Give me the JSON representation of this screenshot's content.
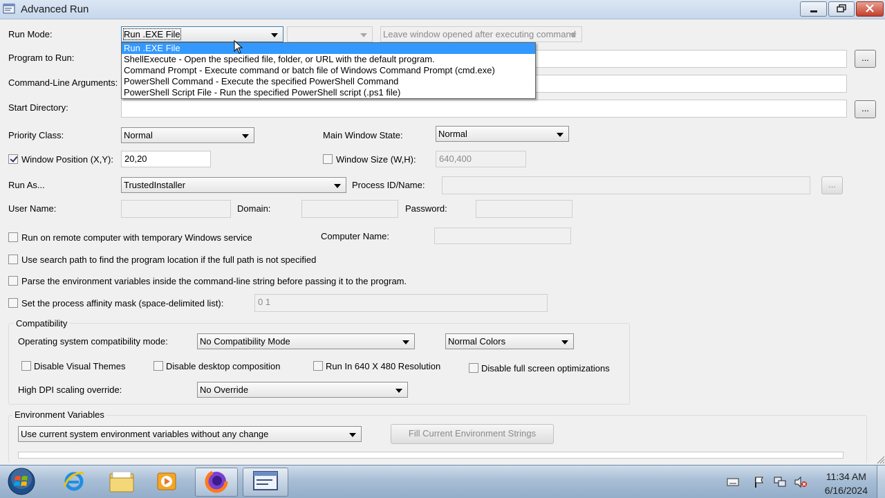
{
  "window": {
    "title": "Advanced Run"
  },
  "run_mode": {
    "label": "Run Mode:",
    "selected": "Run .EXE File",
    "secondary_combo": "",
    "leave_window": "Leave window opened after executing command"
  },
  "run_mode_options": [
    "Run .EXE File",
    "ShellExecute - Open the specified file, folder, or URL with the default program.",
    "Command Prompt - Execute command or batch file of Windows Command Prompt (cmd.exe)",
    "PowerShell Command - Execute the specified PowerShell Command",
    "PowerShell Script File - Run the specified PowerShell script (.ps1 file)"
  ],
  "program": {
    "label": "Program to Run:",
    "value": "",
    "browse": "..."
  },
  "args": {
    "label": "Command-Line Arguments:",
    "value": ""
  },
  "start_dir": {
    "label": "Start Directory:",
    "value": "",
    "browse": "..."
  },
  "priority": {
    "label": "Priority Class:",
    "value": "Normal"
  },
  "main_window_state": {
    "label": "Main Window State:",
    "value": "Normal"
  },
  "window_position": {
    "label": "Window Position (X,Y):",
    "checked": true,
    "value": "20,20"
  },
  "window_size": {
    "label": "Window Size (W,H):",
    "checked": false,
    "value": "640,400"
  },
  "run_as": {
    "label": "Run As...",
    "value": "TrustedInstaller"
  },
  "process_id": {
    "label": "Process ID/Name:",
    "value": "",
    "browse": "..."
  },
  "credentials": {
    "user_label": "User Name:",
    "user_value": "",
    "domain_label": "Domain:",
    "domain_value": "",
    "password_label": "Password:",
    "password_value": ""
  },
  "options": {
    "remote": "Run on remote computer with temporary Windows service",
    "computer_name_label": "Computer Name:",
    "computer_name_value": "",
    "search_path": "Use search path to find the program location if the full path is not specified",
    "parse_env": "Parse the environment variables inside the command-line string before passing it to the program.",
    "affinity": "Set the process affinity mask (space-delimited list):",
    "affinity_value": "0 1"
  },
  "compatibility": {
    "group_label": "Compatibility",
    "os_mode_label": "Operating system compatibility mode:",
    "os_mode_value": "No Compatibility Mode",
    "colors_value": "Normal Colors",
    "disable_visual_themes": "Disable Visual Themes",
    "disable_desktop_composition": "Disable desktop composition",
    "run_640": "Run In 640 X 480 Resolution",
    "disable_fullscreen_opt": "Disable full screen optimizations",
    "dpi_label": "High DPI scaling override:",
    "dpi_value": "No Override"
  },
  "environment": {
    "group_label": "Environment Variables",
    "mode_value": "Use current system environment variables without any change",
    "fill_button": "Fill Current Environment Strings"
  },
  "taskbar": {
    "time": "11:34 AM",
    "date": "6/16/2024",
    "items": [
      "start-orb",
      "internet-explorer",
      "file-explorer",
      "media-player",
      "firefox",
      "advanced-run"
    ]
  },
  "colors": {
    "selection": "#3399ff",
    "window_bg": "#f0f0f0"
  }
}
